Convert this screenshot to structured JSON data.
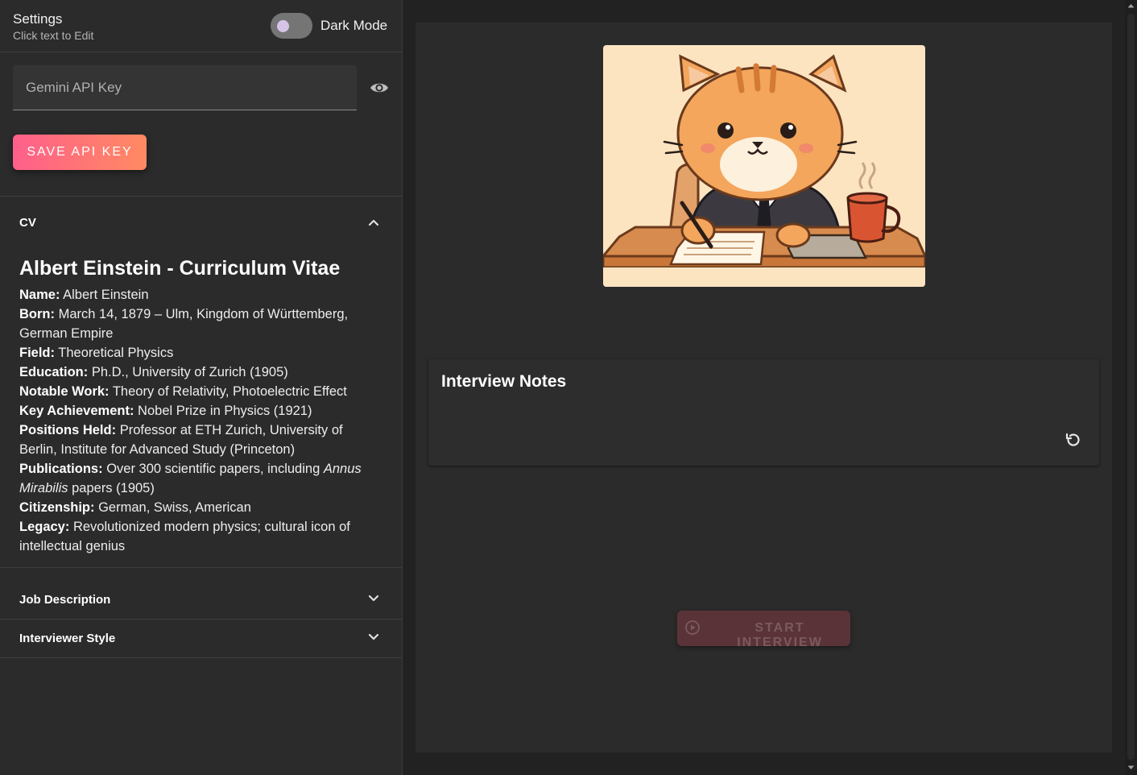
{
  "settings": {
    "title": "Settings",
    "subtitle": "Click text to Edit",
    "dark_mode_label": "Dark Mode",
    "api_key_placeholder": "Gemini API Key",
    "api_key_value": "",
    "save_button": "SAVE API KEY"
  },
  "accordions": {
    "cv": {
      "title": "CV",
      "expanded": true,
      "heading": "Albert Einstein - Curriculum Vitae",
      "fields": [
        {
          "label": "Name:",
          "value": "Albert Einstein"
        },
        {
          "label": "Born:",
          "value": "March 14, 1879 – Ulm, Kingdom of Württemberg, German Empire"
        },
        {
          "label": "Field:",
          "value": "Theoretical Physics"
        },
        {
          "label": "Education:",
          "value": "Ph.D., University of Zurich (1905)"
        },
        {
          "label": "Notable Work:",
          "value": "Theory of Relativity, Photoelectric Effect"
        },
        {
          "label": "Key Achievement:",
          "value": "Nobel Prize in Physics (1921)"
        },
        {
          "label": "Positions Held:",
          "value": "Professor at ETH Zurich, University of Berlin, Institute for Advanced Study (Princeton)"
        },
        {
          "label": "Publications:",
          "value_before": "Over 300 scientific papers, including",
          "value_italic": "Annus Mirabilis",
          "value_after": "papers (1905)"
        },
        {
          "label": "Citizenship:",
          "value": "German, Swiss, American"
        },
        {
          "label": "Legacy:",
          "value": "Revolutionized modern physics; cultural icon of intellectual genius"
        }
      ]
    },
    "job_description": {
      "title": "Job Description",
      "expanded": false
    },
    "interviewer_style": {
      "title": "Interviewer Style",
      "expanded": false
    }
  },
  "main": {
    "notes_title": "Interview Notes",
    "start_button": "START INTERVIEW"
  },
  "colors": {
    "accent_start": "#ff5f8a",
    "accent_end": "#ff8a62",
    "background": "#222222",
    "panel": "#2b2b2b"
  }
}
